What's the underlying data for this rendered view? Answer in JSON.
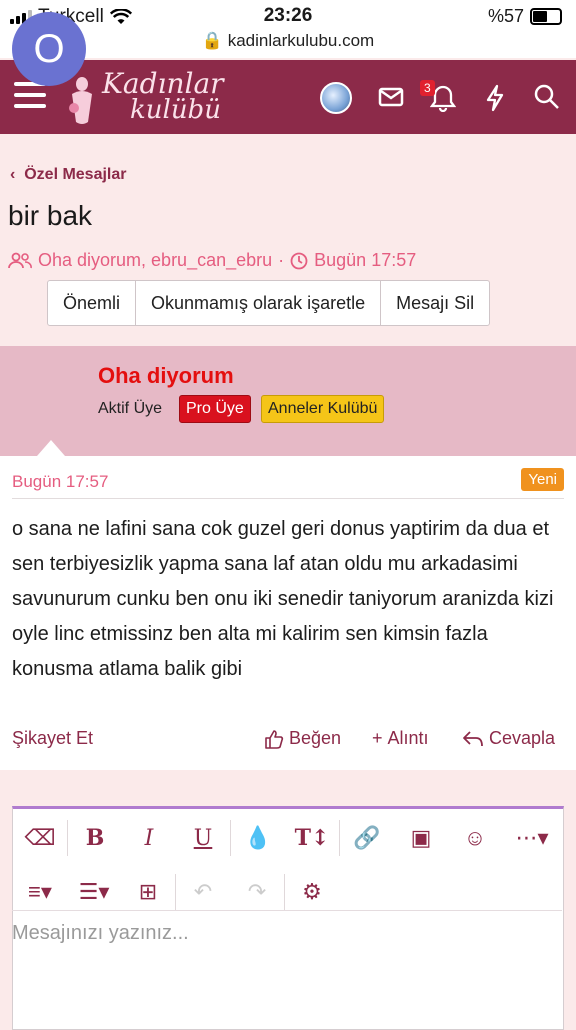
{
  "status": {
    "carrier": "Turkcell",
    "time": "23:26",
    "battery": "%57"
  },
  "url": "kadinlarkulubu.com",
  "logo": {
    "line1": "Kadınlar",
    "line2": "kulübü"
  },
  "nav": {
    "notification_count": "3",
    "colors": {
      "brand": "#8c2a49"
    }
  },
  "breadcrumb": "Özel Mesajlar",
  "thread": {
    "title": "bir bak",
    "participants": "Oha diyorum, ebru_can_ebru",
    "separator": "·",
    "time": "Bugün 17:57"
  },
  "actions": [
    "Önemli",
    "Okunmamış olarak işaretle",
    "Mesajı Sil"
  ],
  "author": {
    "initial": "O",
    "name": "Oha diyorum",
    "title": "Aktif Üye",
    "badges": [
      "Pro Üye",
      "Anneler Kulübü"
    ]
  },
  "post": {
    "date": "Bugün 17:57",
    "new_label": "Yeni",
    "body": "o sana ne lafini sana cok guzel geri donus yaptirim da dua et sen terbiyesizlik yapma sana laf atan oldu mu arkadasimi savunurum cunku ben onu iki senedir taniyorum aranizda kizi oyle linc etmissinz ben alta mi kalirim sen kimsin fazla konusma atlama balik gibi",
    "report": "Şikayet Et",
    "like": "Beğen",
    "quote": "Alıntı",
    "reply": "Cevapla"
  },
  "editor": {
    "placeholder": "Mesajınızı yazınız...",
    "toolbar_row1": [
      "eraser-icon",
      "bold-icon",
      "italic-icon",
      "underline-icon",
      "color-drop-icon",
      "text-size-icon",
      "link-icon",
      "image-icon",
      "emoji-icon",
      "more-icon"
    ],
    "toolbar_row2": [
      "align-icon",
      "list-icon",
      "table-icon",
      "undo-icon",
      "redo-icon",
      "settings-icon"
    ]
  }
}
